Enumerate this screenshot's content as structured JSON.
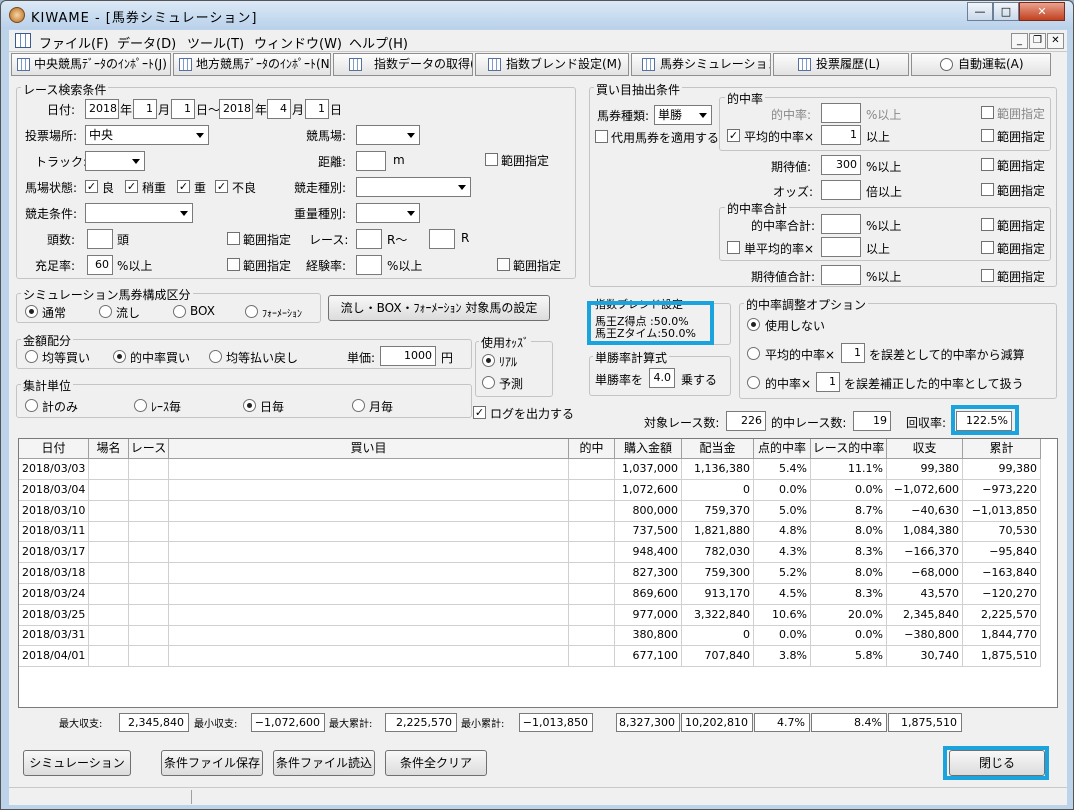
{
  "window": {
    "title": "KIWAME - [馬券シミュレーション]"
  },
  "menu": [
    "ファイル(F)",
    "データ(D)",
    "ツール(T)",
    "ウィンドウ(W)",
    "ヘルプ(H)"
  ],
  "toolbar": [
    "中央競馬ﾃﾞｰﾀのｲﾝﾎﾟｰﾄ(J)",
    "地方競馬ﾃﾞｰﾀのｲﾝﾎﾟｰﾄ(N)",
    "指数データの取得(I)",
    "指数ブレンド設定(M)",
    "馬券シミュレーション(B)",
    "投票履歴(L)",
    "自動運転(A)"
  ],
  "race": {
    "title": "レース検索条件",
    "date_label": "日付:",
    "year_from": "2018",
    "month_from": "1",
    "day_from": "1",
    "year_to": "2018",
    "month_to": "4",
    "day_to": "1",
    "u_year": "年",
    "u_month": "月",
    "u_day": "日",
    "u_day_tilde": "日〜",
    "place_label": "投票場所:",
    "place": "中央",
    "course_label": "競馬場:",
    "track_label": "トラック:",
    "distance_label": "距離:",
    "distance_unit": "m",
    "range": "範囲指定",
    "condition_label": "馬場状態:",
    "cond": [
      "良",
      "稍重",
      "重",
      "不良"
    ],
    "kind_label": "競走種別:",
    "race_cond_label": "競走条件:",
    "weight_label": "重量種別:",
    "heads_label": "頭数:",
    "heads_unit": "頭",
    "race_label": "レース:",
    "race_r1": "R〜",
    "race_r2": "R",
    "fill_label": "充足率:",
    "fill_value": "60",
    "pct_over": "%以上",
    "exp_label": "経験率:"
  },
  "composition": {
    "title": "シミュレーション馬券構成区分",
    "options": [
      "通常",
      "流し",
      "BOX",
      "ﾌｫｰﾒｰｼｮﾝ"
    ],
    "set_button": "流し・BOX・ﾌｫｰﾒｰｼｮﾝ 対象馬の設定"
  },
  "amount": {
    "title": "金額配分",
    "options": [
      "均等買い",
      "的中率買い",
      "均等払い戻し"
    ],
    "unit_label": "単価:",
    "unit_value": "1000",
    "yen": "円"
  },
  "agg": {
    "title": "集計単位",
    "options": [
      "計のみ",
      "ﾚｰｽ毎",
      "日毎",
      "月毎"
    ]
  },
  "odds": {
    "title": "使用ｵｯｽﾞ",
    "options": [
      "ﾘｱﾙ",
      "予測"
    ],
    "log_label": "ログを出力する"
  },
  "extract": {
    "title": "買い目抽出条件",
    "kind_label": "馬券種類:",
    "kind": "単勝",
    "substitute": "代用馬券を適用する",
    "hit_title": "的中率",
    "hit_label": "的中率:",
    "pct_over": "%以上",
    "avg_hit": "平均的中率×",
    "avg_val": "1",
    "over": "以上",
    "range": "範囲指定",
    "exp_label": "期待値:",
    "exp_val": "300",
    "odds_label": "オッズ:",
    "odds_unit": "倍以上",
    "sum_title": "的中率合計",
    "sum_label": "的中率合計:",
    "single_avg": "単平均的率×",
    "exp_sum_label": "期待値合計:"
  },
  "blend": {
    "title": "指数ブレンド設定",
    "lines": [
      "馬王Z得点 :50.0%",
      "馬王Zタイム:50.0%"
    ]
  },
  "win": {
    "title": "単勝率計算式",
    "label": "単勝率を",
    "val": "4.0",
    "unit": "乗する"
  },
  "adjust": {
    "title": "的中率調整オプション",
    "opt1": "使用しない",
    "opt2_pre": "平均的中率×",
    "opt2_val": "1",
    "opt2_post": "を誤差として的中率から減算",
    "opt3_pre": "的中率×",
    "opt3_val": "1",
    "opt3_post": "を誤差補正した的中率として扱う"
  },
  "stats": {
    "target_label": "対象レース数:",
    "target": "226",
    "hit_label": "的中レース数:",
    "hit": "19",
    "return_label": "回収率:",
    "return": "122.5%"
  },
  "table": {
    "headers": [
      "日付",
      "場名",
      "レース",
      "買い目",
      "的中",
      "購入金額",
      "配当金",
      "点的中率",
      "レース的中率",
      "収支",
      "累計"
    ],
    "rows": [
      [
        "2018/03/03",
        "",
        "",
        "",
        "",
        "1,037,000",
        "1,136,380",
        "5.4%",
        "11.1%",
        "99,380",
        "99,380"
      ],
      [
        "2018/03/04",
        "",
        "",
        "",
        "",
        "1,072,600",
        "0",
        "0.0%",
        "0.0%",
        "−1,072,600",
        "−973,220"
      ],
      [
        "2018/03/10",
        "",
        "",
        "",
        "",
        "800,000",
        "759,370",
        "5.0%",
        "8.7%",
        "−40,630",
        "−1,013,850"
      ],
      [
        "2018/03/11",
        "",
        "",
        "",
        "",
        "737,500",
        "1,821,880",
        "4.8%",
        "8.0%",
        "1,084,380",
        "70,530"
      ],
      [
        "2018/03/17",
        "",
        "",
        "",
        "",
        "948,400",
        "782,030",
        "4.3%",
        "8.3%",
        "−166,370",
        "−95,840"
      ],
      [
        "2018/03/18",
        "",
        "",
        "",
        "",
        "827,300",
        "759,300",
        "5.2%",
        "8.0%",
        "−68,000",
        "−163,840"
      ],
      [
        "2018/03/24",
        "",
        "",
        "",
        "",
        "869,600",
        "913,170",
        "4.5%",
        "8.3%",
        "43,570",
        "−120,270"
      ],
      [
        "2018/03/25",
        "",
        "",
        "",
        "",
        "977,000",
        "3,322,840",
        "10.6%",
        "20.0%",
        "2,345,840",
        "2,225,570"
      ],
      [
        "2018/03/31",
        "",
        "",
        "",
        "",
        "380,800",
        "0",
        "0.0%",
        "0.0%",
        "−380,800",
        "1,844,770"
      ],
      [
        "2018/04/01",
        "",
        "",
        "",
        "",
        "677,100",
        "707,840",
        "3.8%",
        "5.8%",
        "30,740",
        "1,875,510"
      ]
    ]
  },
  "summary": {
    "max_profit_label": "最大収支:",
    "max_profit": "2,345,840",
    "min_profit_label": "最小収支:",
    "min_profit": "−1,072,600",
    "max_cum_label": "最大累計:",
    "max_cum": "2,225,570",
    "min_cum_label": "最小累計:",
    "min_cum": "−1,013,850",
    "total_buy": "8,327,300",
    "total_pay": "10,202,810",
    "total_hit": "4.7%",
    "total_race_hit": "8.4%",
    "total_cum": "1,875,510"
  },
  "buttons": {
    "simulate": "シミュレーション",
    "save": "条件ファイル保存",
    "load": "条件ファイル読込",
    "clear": "条件全クリア",
    "close": "閉じる"
  }
}
